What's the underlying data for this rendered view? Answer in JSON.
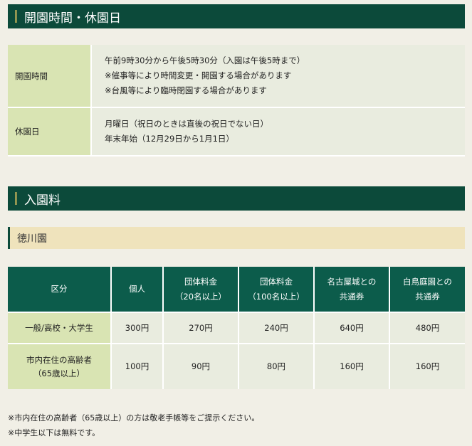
{
  "section_hours": {
    "title": "開園時間・休園日",
    "rows": [
      {
        "label": "開園時間",
        "lines": [
          "午前9時30分から午後5時30分（入園は午後5時まで）",
          "※催事等により時間変更・開園する場合があります",
          "※台風等により臨時閉園する場合があります"
        ]
      },
      {
        "label": "休園日",
        "lines": [
          "月曜日（祝日のときは直後の祝日でない日）",
          "年末年始（12月29日から1月1日）"
        ]
      }
    ]
  },
  "section_fees": {
    "title": "入園料",
    "garden": "徳川園",
    "headers": [
      "区分",
      "個人",
      "団体料金",
      "（20名以上）",
      "団体料金",
      "（100名以上）",
      "名古屋城との",
      "共通券",
      "白鳥庭園との",
      "共通券"
    ],
    "rows": [
      {
        "cat": [
          "一般/高校・大学生"
        ],
        "values": [
          "300円",
          "270円",
          "240円",
          "640円",
          "480円"
        ]
      },
      {
        "cat": [
          "市内在住の高齢者",
          "（65歳以上）"
        ],
        "values": [
          "100円",
          "90円",
          "80円",
          "160円",
          "160円"
        ]
      }
    ],
    "notes": [
      "※市内在住の高齢者（65歳以上）の方は敬老手帳等をご提示ください。",
      "※中学生以下は無料です。"
    ]
  }
}
